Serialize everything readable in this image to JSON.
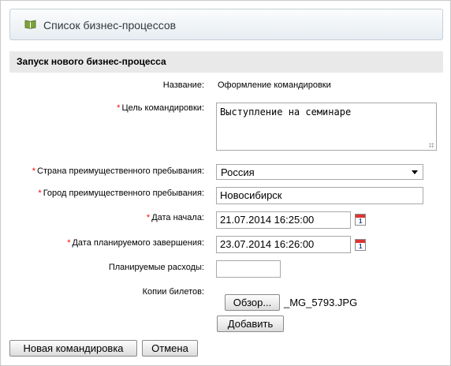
{
  "toolbar": {
    "title": "Список бизнес-процессов",
    "icon": "book-icon"
  },
  "section": {
    "title": "Запуск нового бизнес-процесса"
  },
  "fields": {
    "name": {
      "label": "Название:",
      "value": "Оформление командировки"
    },
    "purpose": {
      "label": "Цель командировки:",
      "required": "*",
      "value": "Выступление на семинаре"
    },
    "country": {
      "label": "Страна преимущественного пребывания:",
      "required": "*",
      "value": "Россия"
    },
    "city": {
      "label": "Город преимущественного пребывания:",
      "required": "*",
      "value": "Новосибирск"
    },
    "start_date": {
      "label": "Дата начала:",
      "required": "*",
      "value": "21.07.2014 16:25:00"
    },
    "end_date": {
      "label": "Дата планируемого завершения:",
      "required": "*",
      "value": "23.07.2014 16:26:00"
    },
    "expenses": {
      "label": "Планируемые расходы:",
      "value": ""
    },
    "tickets": {
      "label": "Копии билетов:",
      "browse_label": "Обзор...",
      "file_name": "_MG_5793.JPG",
      "add_label": "Добавить"
    }
  },
  "calendar": {
    "day": "1"
  },
  "actions": {
    "submit_label": "Новая командировка",
    "cancel_label": "Отмена"
  },
  "colors": {
    "required": "#ff0000",
    "section_bg": "#e9e9e9",
    "toolbar_border": "#c5cfd6"
  }
}
